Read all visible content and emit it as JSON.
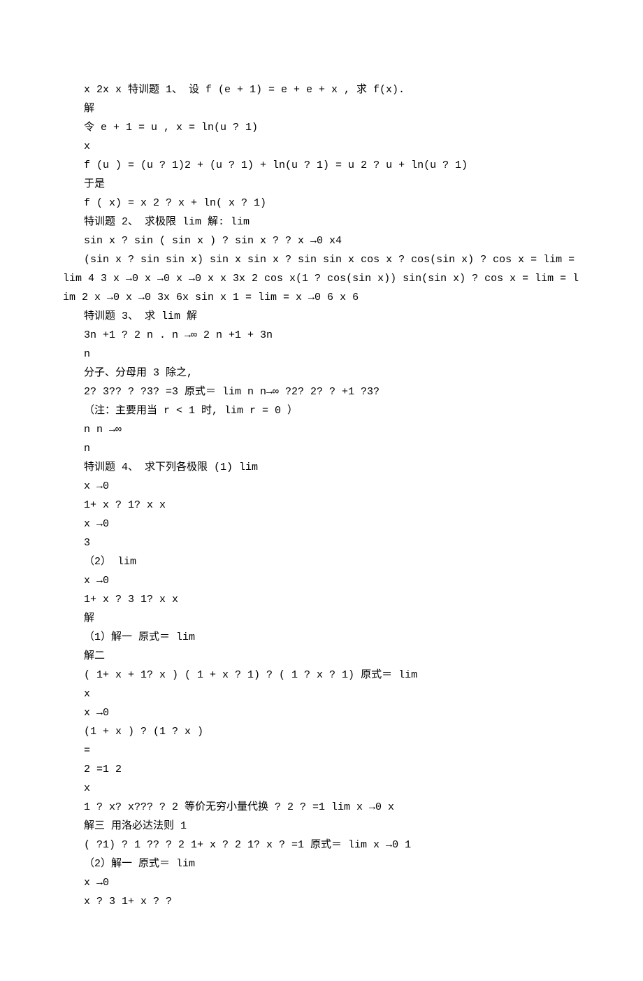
{
  "lines": [
    {
      "indent": true,
      "text": "x 2x x 特训题 1、 设 f (e + 1) = e + e + x , 求 f(x)."
    },
    {
      "indent": true,
      "text": "解"
    },
    {
      "indent": true,
      "text": "令 e + 1 = u ,  x = ln(u ? 1)"
    },
    {
      "indent": true,
      "text": "x"
    },
    {
      "indent": true,
      "text": "f (u ) = (u ? 1)2 + (u ? 1) + ln(u ? 1) = u 2 ? u + ln(u ? 1)"
    },
    {
      "indent": true,
      "text": "于是"
    },
    {
      "indent": true,
      "text": "f ( x) = x 2 ? x + ln( x ? 1)"
    },
    {
      "indent": true,
      "text": "特训题 2、 求极限 lim 解:  lim"
    },
    {
      "indent": true,
      "text": "sin x ? sin ( sin x ) ? sin x ? ? x →0 x4"
    },
    {
      "indent": true,
      "text": "(sin x ? sin sin x) sin x sin x ? sin sin x cos x ? cos(sin x) ? cos x = lim = lim 4 3 x →0 x →0 x →0 x x 3x 2 cos x(1 ? cos(sin x)) sin(sin x) ? cos x = lim = lim 2 x →0 x →0 3x 6x sin x 1 = lim = x →0 6 x 6"
    },
    {
      "indent": true,
      "text": "特训题 3、 求 lim 解"
    },
    {
      "indent": true,
      "text": "3n +1 ? 2 n . n →∞ 2 n +1 + 3n"
    },
    {
      "indent": true,
      "text": "n"
    },
    {
      "indent": true,
      "text": "分子、分母用 3 除之,"
    },
    {
      "indent": true,
      "text": "2? 3?? ? ?3? =3 原式＝ lim n n→∞ ?2? 2? ? +1 ?3?"
    },
    {
      "indent": true,
      "text": "（注：主要用当 r < 1 时,  lim r = 0 ）"
    },
    {
      "indent": true,
      "text": "n n →∞"
    },
    {
      "indent": true,
      "text": "n"
    },
    {
      "indent": true,
      "text": "特训题 4、 求下列各极限  (1)  lim"
    },
    {
      "indent": true,
      "text": "x →0"
    },
    {
      "indent": true,
      "text": "1+ x ? 1? x x"
    },
    {
      "indent": true,
      "text": "x →0"
    },
    {
      "indent": true,
      "text": "3"
    },
    {
      "indent": true,
      "text": "（2） lim"
    },
    {
      "indent": true,
      "text": "x →0"
    },
    {
      "indent": true,
      "text": "1+ x ? 3 1? x x"
    },
    {
      "indent": true,
      "text": "解"
    },
    {
      "indent": true,
      "text": "（1）解一 原式＝ lim"
    },
    {
      "indent": true,
      "text": "解二"
    },
    {
      "indent": true,
      "text": "( 1+ x + 1? x )  ( 1 + x ? 1) ? ( 1 ? x ? 1) 原式＝ lim"
    },
    {
      "indent": true,
      "text": "x"
    },
    {
      "indent": true,
      "text": "x →0"
    },
    {
      "indent": true,
      "text": "(1 + x ) ? (1 ? x )"
    },
    {
      "indent": true,
      "text": "="
    },
    {
      "indent": true,
      "text": "2 =1 2"
    },
    {
      "indent": true,
      "text": "x"
    },
    {
      "indent": true,
      "text": "1 ? x? x??? ? 2 等价无穷小量代换 ? 2 ? =1 lim x →0 x"
    },
    {
      "indent": true,
      "text": "解三 用洛必达法则 1"
    },
    {
      "indent": true,
      "text": "( ?1) ? 1 ?? ? 2 1+ x ? 2 1? x ? =1 原式＝ lim x →0 1"
    },
    {
      "indent": true,
      "text": "（2）解一 原式＝ lim"
    },
    {
      "indent": true,
      "text": "x →0"
    },
    {
      "indent": true,
      "text": "x ? 3 1+ x ? ?"
    }
  ]
}
